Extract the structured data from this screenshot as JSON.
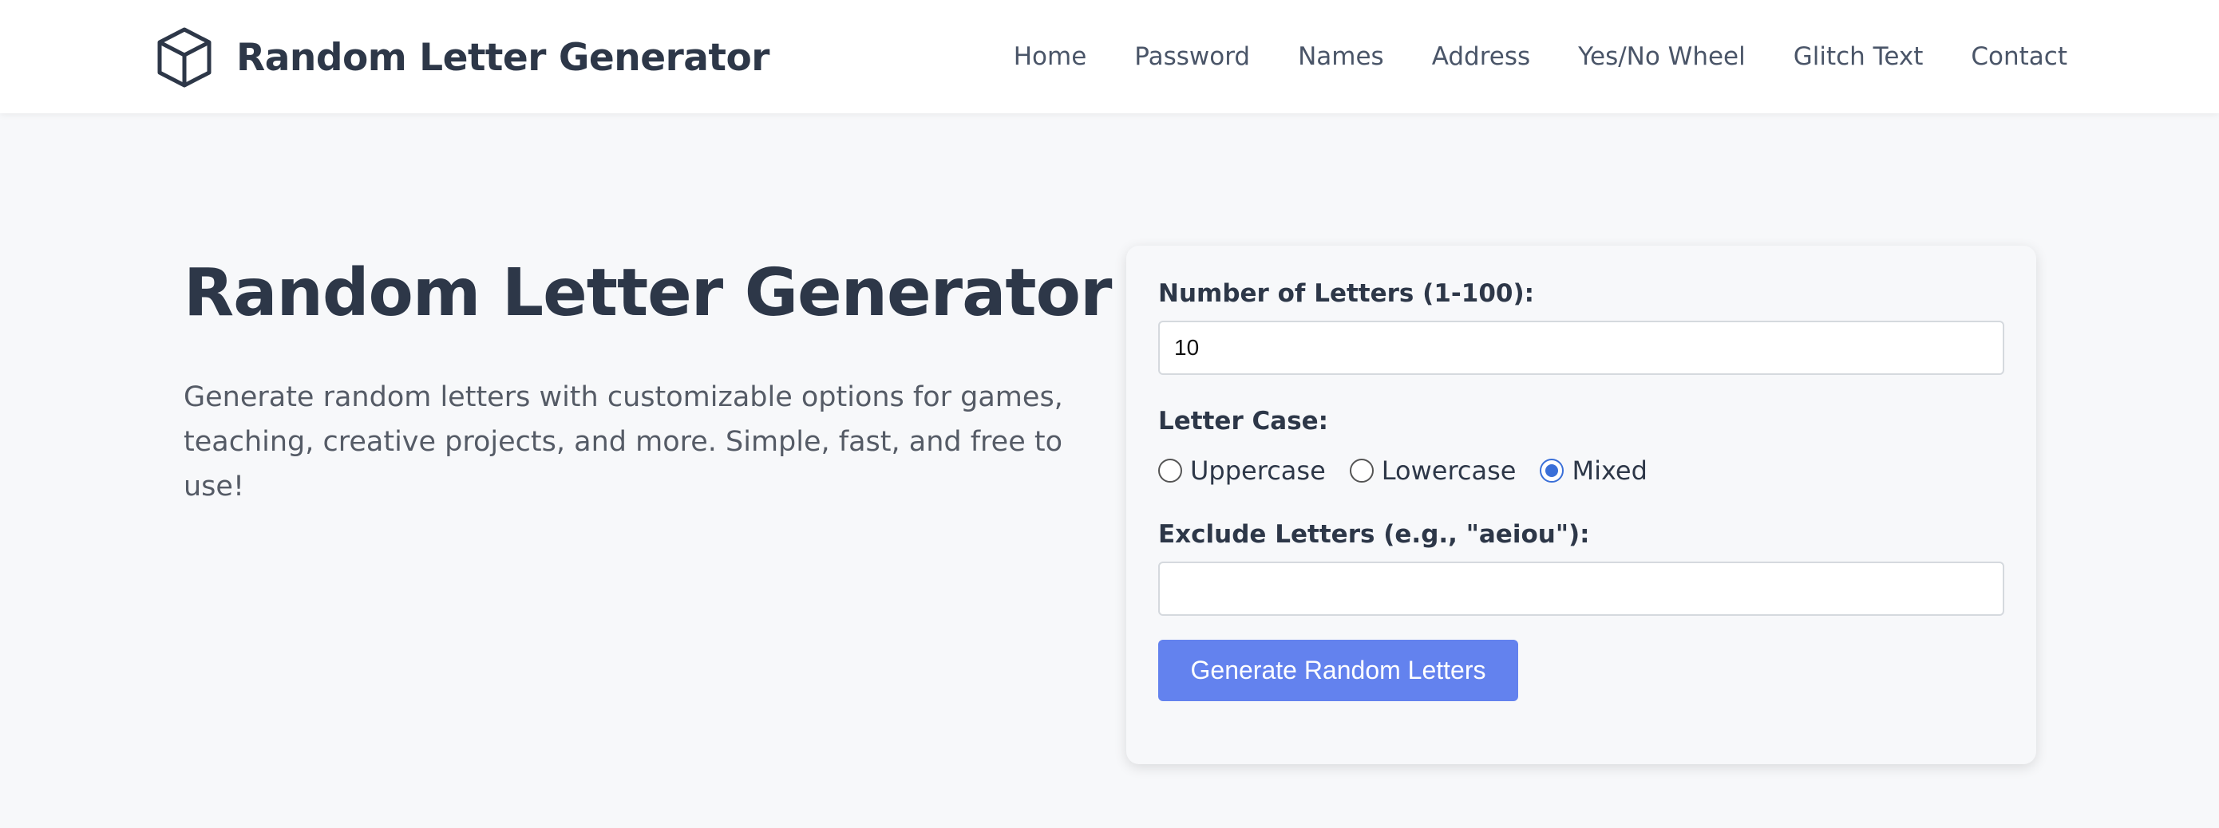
{
  "header": {
    "logo_icon": "cube-icon",
    "site_name": "Random Letter Generator",
    "nav": [
      {
        "label": "Home"
      },
      {
        "label": "Password"
      },
      {
        "label": "Names"
      },
      {
        "label": "Address"
      },
      {
        "label": "Yes/No Wheel"
      },
      {
        "label": "Glitch Text"
      },
      {
        "label": "Contact"
      }
    ]
  },
  "hero": {
    "title": "Random Letter Generator",
    "description": "Generate random letters with customizable options for games, teaching, creative projects, and more. Simple, fast, and free to use!"
  },
  "form": {
    "count_label": "Number of Letters (1-100):",
    "count_value": "10",
    "case_label": "Letter Case:",
    "case_options": [
      {
        "label": "Uppercase",
        "checked": false
      },
      {
        "label": "Lowercase",
        "checked": false
      },
      {
        "label": "Mixed",
        "checked": true
      }
    ],
    "exclude_label": "Exclude Letters (e.g., \"aeiou\"):",
    "exclude_value": "",
    "generate_label": "Generate Random Letters"
  },
  "colors": {
    "accent": "#6382ee",
    "radio_selected": "#3a6fd8",
    "text_dark": "#2d3748",
    "background": "#f7f8fa"
  }
}
